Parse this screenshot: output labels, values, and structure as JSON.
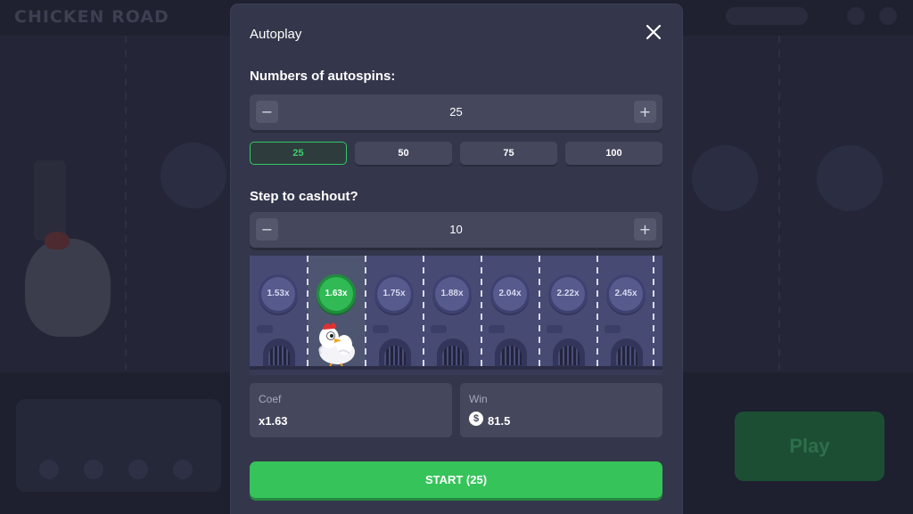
{
  "background": {
    "logo_text": "CHICKEN ROAD",
    "play_label": "Play"
  },
  "modal": {
    "title": "Autoplay",
    "autospins": {
      "label": "Numbers of autospins:",
      "value": "25",
      "decrement_symbol": "−",
      "increment_symbol": "+",
      "presets": [
        "25",
        "50",
        "75",
        "100"
      ],
      "selected_preset": "25"
    },
    "cashout": {
      "label": "Step to cashout?",
      "value": "10",
      "decrement_symbol": "−",
      "increment_symbol": "+"
    },
    "lanes": {
      "multipliers": [
        "1.53x",
        "1.63x",
        "1.75x",
        "1.88x",
        "2.04x",
        "2.22x",
        "2.45x"
      ],
      "active_index": 1
    },
    "coef": {
      "label": "Coef",
      "value": "x1.63"
    },
    "win": {
      "label": "Win",
      "currency_icon": "dollar-icon",
      "value": "81.5"
    },
    "start_label": "START (25)"
  },
  "colors": {
    "accent_green": "#36c35a",
    "modal_bg": "#34374b",
    "control_bg": "#45485c",
    "selected_border": "#31c865"
  }
}
